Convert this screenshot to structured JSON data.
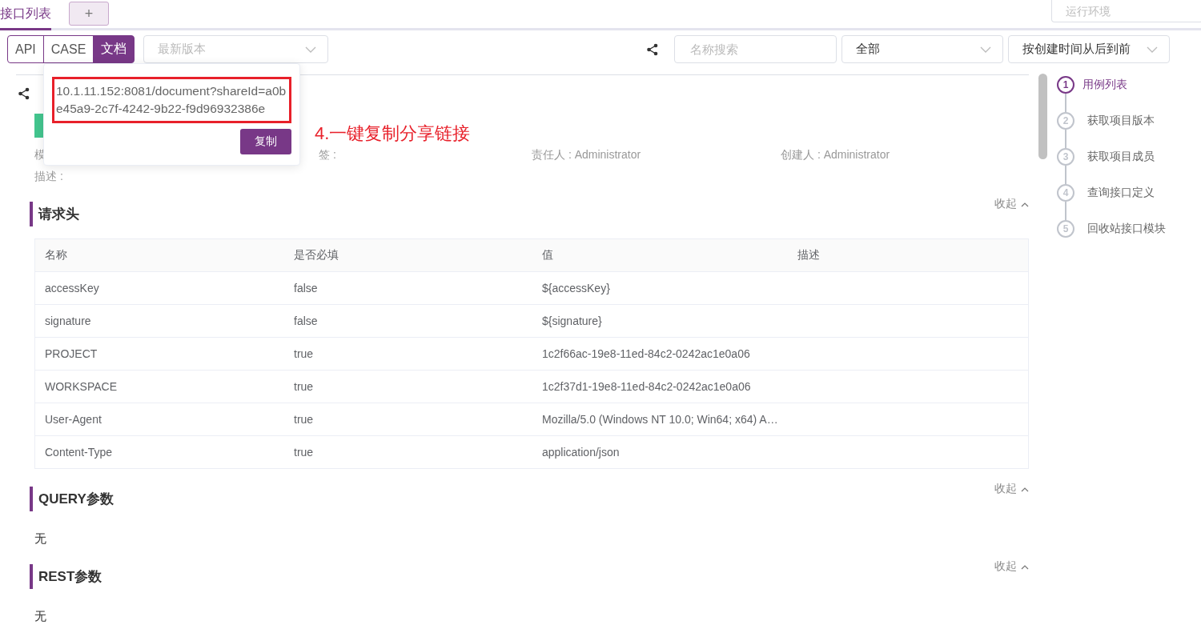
{
  "tabs": [
    {
      "label": "接口列表",
      "selected": true
    }
  ],
  "add_tab": {
    "label": "+"
  },
  "environment": {
    "placeholder": "运行环境"
  },
  "mode_switch": [
    {
      "label": "API",
      "selected": false
    },
    {
      "label": "CASE",
      "selected": false
    },
    {
      "label": "文档",
      "selected": true
    }
  ],
  "version_select": {
    "placeholder": "最新版本"
  },
  "search": {
    "placeholder": "名称搜索"
  },
  "filter_select": {
    "value": "全部"
  },
  "sort_select": {
    "value": "按创建时间从后到前"
  },
  "share_popover": {
    "link": "10.1.11.152:8081/document?shareId=a0be45a9-2c7f-4242-9b22-f9d96932386e",
    "copy_button": "复制"
  },
  "annotation": "4.一键复制分享链接",
  "meta": [
    "模",
    "签 :",
    "责任人 : Administrator",
    "创建人 : Administrator"
  ],
  "description": "描述 :",
  "sections": [
    {
      "title": "请求头",
      "collapse": "收起",
      "kind": "table",
      "columns": [
        "名称",
        "是否必填",
        "值",
        "描述"
      ],
      "rows": [
        [
          "accessKey",
          "false",
          "${accessKey}",
          ""
        ],
        [
          "signature",
          "false",
          "${signature}",
          ""
        ],
        [
          "PROJECT",
          "true",
          "1c2f66ac-19e8-11ed-84c2-0242ac1e0a06",
          ""
        ],
        [
          "WORKSPACE",
          "true",
          "1c2f37d1-19e8-11ed-84c2-0242ac1e0a06",
          ""
        ],
        [
          "User-Agent",
          "true",
          "Mozilla/5.0 (Windows NT 10.0; Win64; x64) A…",
          ""
        ],
        [
          "Content-Type",
          "true",
          "application/json",
          ""
        ]
      ]
    },
    {
      "title": "QUERY参数",
      "collapse": "收起",
      "kind": "empty",
      "text": "无"
    },
    {
      "title": "REST参数",
      "collapse": "收起",
      "kind": "empty",
      "text": "无"
    }
  ],
  "steps": [
    {
      "number": "1",
      "label": "用例列表",
      "selected": true
    },
    {
      "number": "2",
      "label": "获取项目版本",
      "selected": false
    },
    {
      "number": "3",
      "label": "获取项目成员",
      "selected": false
    },
    {
      "number": "4",
      "label": "查询接口定义",
      "selected": false
    },
    {
      "number": "5",
      "label": "回收站接口模块",
      "selected": false
    }
  ]
}
